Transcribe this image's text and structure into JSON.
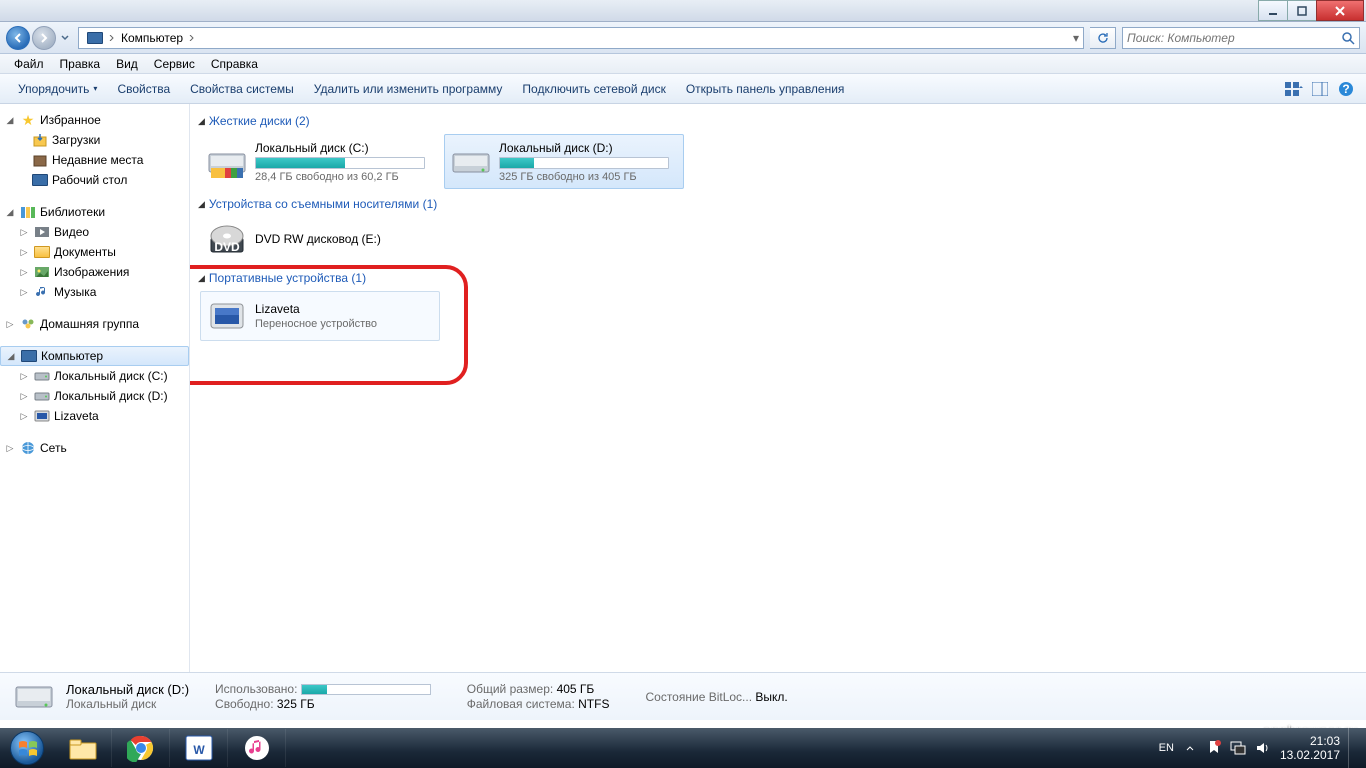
{
  "titlebar": {},
  "navbar": {
    "breadcrumb": "Компьютер"
  },
  "search": {
    "placeholder": "Поиск: Компьютер"
  },
  "menubar": [
    "Файл",
    "Правка",
    "Вид",
    "Сервис",
    "Справка"
  ],
  "toolbar": {
    "organize": "Упорядочить",
    "properties": "Свойства",
    "system_props": "Свойства системы",
    "uninstall": "Удалить или изменить программу",
    "map_drive": "Подключить сетевой диск",
    "control_panel": "Открыть панель управления"
  },
  "sidebar": {
    "favorites": {
      "label": "Избранное",
      "items": [
        "Загрузки",
        "Недавние места",
        "Рабочий стол"
      ]
    },
    "libraries": {
      "label": "Библиотеки",
      "items": [
        "Видео",
        "Документы",
        "Изображения",
        "Музыка"
      ]
    },
    "homegroup": {
      "label": "Домашняя группа"
    },
    "computer": {
      "label": "Компьютер",
      "items": [
        "Локальный диск (C:)",
        "Локальный диск (D:)",
        "Lizaveta"
      ]
    },
    "network": {
      "label": "Сеть"
    }
  },
  "content": {
    "hdd": {
      "header": "Жесткие диски (2)",
      "drives": [
        {
          "name": "Локальный диск (C:)",
          "sub": "28,4 ГБ свободно из 60,2 ГБ",
          "fill": 53
        },
        {
          "name": "Локальный диск (D:)",
          "sub": "325 ГБ свободно из 405 ГБ",
          "fill": 20
        }
      ]
    },
    "removable": {
      "header": "Устройства со съемными носителями (1)",
      "drives": [
        {
          "name": "DVD RW дисковод (E:)"
        }
      ]
    },
    "portable": {
      "header": "Портативные устройства (1)",
      "drives": [
        {
          "name": "Lizaveta",
          "sub": "Переносное устройство"
        }
      ]
    }
  },
  "details": {
    "title": "Локальный диск (D:)",
    "type": "Локальный диск",
    "used_lbl": "Использовано",
    "used": "",
    "free_lbl": "Свободно",
    "free": "325 ГБ",
    "total_lbl": "Общий размер",
    "total": "405 ГБ",
    "fs_lbl": "Файловая система",
    "fs": "NTFS",
    "bitlocker_lbl": "Состояние BitLoc...",
    "bitlocker": "Выкл."
  },
  "taskbar": {
    "lang": "EN",
    "time": "21:03",
    "date": "13.02.2017"
  },
  "watermark": ".appbrowser.ru"
}
